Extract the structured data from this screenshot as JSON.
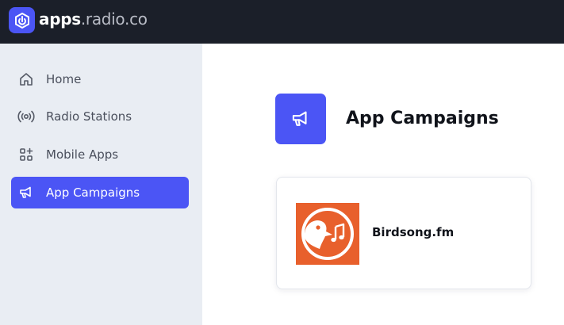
{
  "brand": {
    "name_strong": "apps",
    "name_light": ".radio.co",
    "icon": "radio-co-logo-icon",
    "color": "#4b55f5"
  },
  "sidebar": {
    "items": [
      {
        "label": "Home",
        "icon": "home-icon",
        "active": false
      },
      {
        "label": "Radio Stations",
        "icon": "broadcast-icon",
        "active": false
      },
      {
        "label": "Mobile Apps",
        "icon": "apps-grid-icon",
        "active": false
      },
      {
        "label": "App Campaigns",
        "icon": "megaphone-icon",
        "active": true
      }
    ]
  },
  "main": {
    "title": "App Campaigns",
    "header_icon": "megaphone-icon",
    "cards": [
      {
        "name": "Birdsong.fm",
        "thumbnail": "birdsong-logo",
        "thumbnail_color": "#e8602c"
      }
    ]
  },
  "colors": {
    "topbar": "#1b1f29",
    "sidebar": "#e9edf3",
    "accent": "#4b55f5"
  }
}
